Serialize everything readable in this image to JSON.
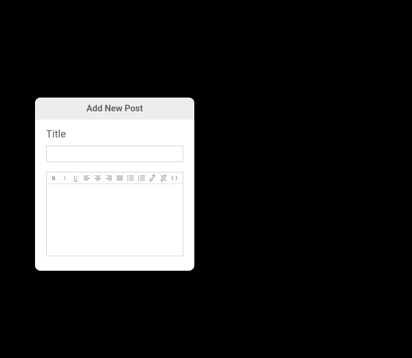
{
  "panel": {
    "header": "Add New Post",
    "title_label": "Title",
    "title_value": "",
    "body_value": ""
  },
  "toolbar": {
    "bold": "B",
    "italic": "I",
    "underline": "U"
  }
}
